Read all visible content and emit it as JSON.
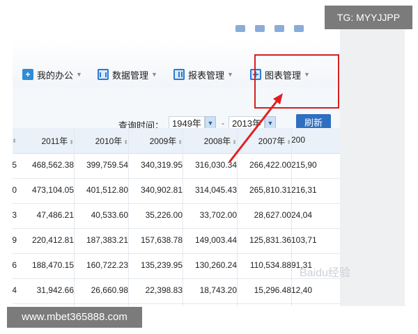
{
  "nav": {
    "items": [
      {
        "label": "我的办公",
        "icon": "plus-icon"
      },
      {
        "label": "数据管理",
        "icon": "data-icon"
      },
      {
        "label": "报表管理",
        "icon": "report-icon"
      },
      {
        "label": "图表管理",
        "icon": "chart-icon"
      }
    ]
  },
  "query": {
    "label": "查询时间：",
    "start_year": "1949年",
    "separator": "-",
    "end_year": "2013年",
    "refresh_label": "刷新"
  },
  "table": {
    "headers": [
      "2011年",
      "2010年",
      "2009年",
      "2008年",
      "2007年",
      "200"
    ],
    "rows": [
      {
        "lead": "5",
        "cells": [
          "468,562.38",
          "399,759.54",
          "340,319.95",
          "316,030.34",
          "266,422.00",
          "215,90"
        ]
      },
      {
        "lead": "0",
        "cells": [
          "473,104.05",
          "401,512.80",
          "340,902.81",
          "314,045.43",
          "265,810.31",
          "216,31"
        ]
      },
      {
        "lead": "3",
        "cells": [
          "47,486.21",
          "40,533.60",
          "35,226.00",
          "33,702.00",
          "28,627.00",
          "24,04"
        ]
      },
      {
        "lead": "9",
        "cells": [
          "220,412.81",
          "187,383.21",
          "157,638.78",
          "149,003.44",
          "125,831.36",
          "103,71"
        ]
      },
      {
        "lead": "6",
        "cells": [
          "188,470.15",
          "160,722.23",
          "135,239.95",
          "130,260.24",
          "110,534.88",
          "91,31"
        ]
      },
      {
        "lead": "4",
        "cells": [
          "31,942.66",
          "26,660.98",
          "22,398.83",
          "18,743.20",
          "15,296.48",
          "12,40"
        ]
      }
    ]
  },
  "overlay": {
    "tg_badge": "TG: MYYJJPP",
    "url_badge": "www.mbet365888.com",
    "watermark": "Baidu经验",
    "highlight_color": "#d61f1f",
    "accent": "#2a7fd0"
  }
}
